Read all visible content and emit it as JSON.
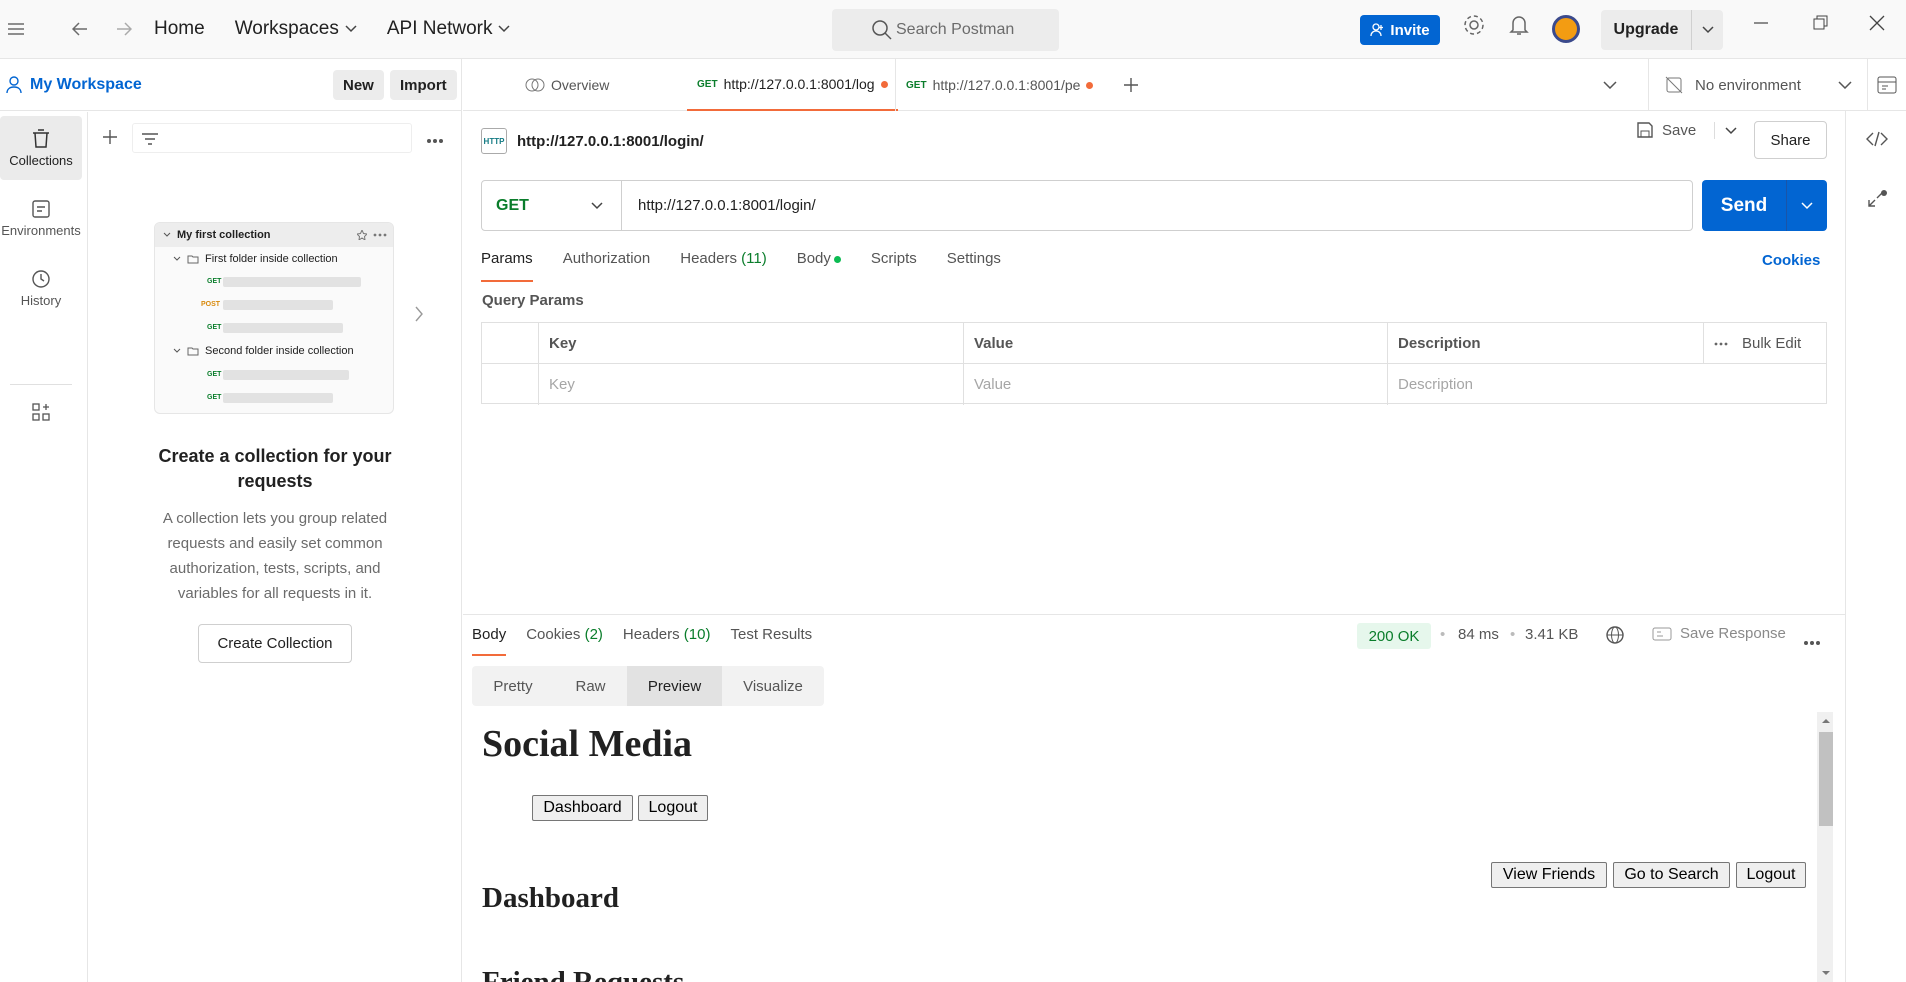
{
  "topbar": {
    "nav_home": "Home",
    "nav_workspaces": "Workspaces",
    "nav_api_network": "API Network",
    "search_placeholder": "Search Postman",
    "invite_label": "Invite",
    "upgrade_label": "Upgrade"
  },
  "sidebar": {
    "workspace_name": "My Workspace",
    "new_label": "New",
    "import_label": "Import",
    "rail": [
      {
        "label": "Collections",
        "icon": "collections-icon"
      },
      {
        "label": "Environments",
        "icon": "environments-icon"
      },
      {
        "label": "History",
        "icon": "history-icon"
      }
    ],
    "preview": {
      "collection": "My first collection",
      "folder1": "First folder inside collection",
      "folder2": "Second folder inside collection",
      "methods": [
        "GET",
        "POST",
        "GET",
        "GET",
        "GET"
      ]
    },
    "empty_title": "Create a collection for your requests",
    "empty_desc": "A collection lets you group related requests and easily set common authorization, tests, scripts, and variables for all requests in it.",
    "create_label": "Create Collection"
  },
  "tabs": {
    "overview": "Overview",
    "tab1_method": "GET",
    "tab1_url": "http://127.0.0.1:8001/log",
    "tab2_method": "GET",
    "tab2_url": "http://127.0.0.1:8001/pe",
    "environment": "No environment"
  },
  "request": {
    "title": "http://127.0.0.1:8001/login/",
    "save_label": "Save",
    "share_label": "Share",
    "method": "GET",
    "url": "http://127.0.0.1:8001/login/",
    "send_label": "Send",
    "tabs": {
      "params": "Params",
      "authorization": "Authorization",
      "headers": "Headers",
      "headers_count": "(11)",
      "body": "Body",
      "scripts": "Scripts",
      "settings": "Settings"
    },
    "cookies_link": "Cookies",
    "query_params_label": "Query Params",
    "table": {
      "col_key": "Key",
      "col_value": "Value",
      "col_description": "Description",
      "bulk_edit": "Bulk Edit",
      "ph_key": "Key",
      "ph_value": "Value",
      "ph_description": "Description"
    }
  },
  "response": {
    "tabs": {
      "body": "Body",
      "cookies": "Cookies",
      "cookies_count": "(2)",
      "headers": "Headers",
      "headers_count": "(10)",
      "test_results": "Test Results"
    },
    "status": "200 OK",
    "time": "84 ms",
    "size": "3.41 KB",
    "save_response": "Save Response",
    "view_tabs": [
      "Pretty",
      "Raw",
      "Preview",
      "Visualize"
    ],
    "preview": {
      "heading": "Social Media",
      "nav_dashboard": "Dashboard",
      "nav_logout": "Logout",
      "btn_view_friends": "View Friends",
      "btn_go_search": "Go to Search",
      "btn_logout": "Logout",
      "heading2": "Dashboard",
      "heading3": "Friend Requests"
    }
  },
  "colors": {
    "accent_orange": "#f26b3a",
    "brand_blue": "#0265d2",
    "get_green": "#0a7d2b"
  }
}
